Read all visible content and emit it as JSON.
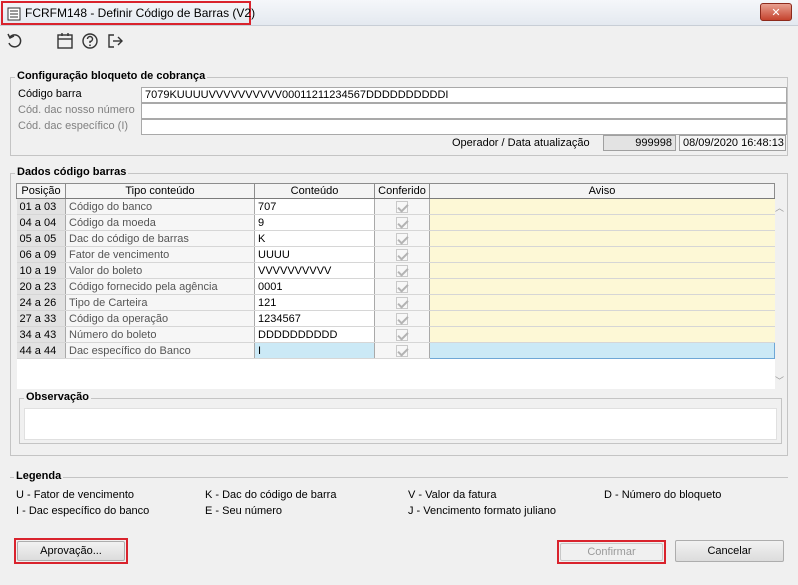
{
  "window": {
    "title": "FCRFM148 - Definir Código de Barras (V2)",
    "close_glyph": "✕"
  },
  "toolbar": {
    "icons": [
      "refresh-icon",
      "calendar-icon",
      "help-icon",
      "exit-icon"
    ]
  },
  "config": {
    "title": "Configuração bloqueto de cobrança",
    "codigo_barra_label": "Código barra",
    "codigo_barra_value": "7079KUUUUVVVVVVVVVV00011211234567DDDDDDDDDDI",
    "dac_nosso_numero_label": "Cód. dac nosso número",
    "dac_especifico_label": "Cód. dac específico (I)",
    "operador_label": "Operador / Data atualização",
    "operador_value": "999998",
    "data_value": "08/09/2020 16:48:13"
  },
  "dados": {
    "title": "Dados código barras",
    "columns": [
      "Posição",
      "Tipo conteúdo",
      "Conteúdo",
      "Conferido",
      "Aviso"
    ],
    "rows": [
      {
        "posicao": "01 a 03",
        "tipo": "Código do banco",
        "conteudo": "707",
        "conferido": true,
        "aviso": ""
      },
      {
        "posicao": "04 a 04",
        "tipo": "Código da moeda",
        "conteudo": "9",
        "conferido": true,
        "aviso": ""
      },
      {
        "posicao": "05 a 05",
        "tipo": "Dac do código de barras",
        "conteudo": "K",
        "conferido": true,
        "aviso": ""
      },
      {
        "posicao": "06 a 09",
        "tipo": "Fator de vencimento",
        "conteudo": "UUUU",
        "conferido": true,
        "aviso": ""
      },
      {
        "posicao": "10 a 19",
        "tipo": "Valor do boleto",
        "conteudo": "VVVVVVVVVV",
        "conferido": true,
        "aviso": ""
      },
      {
        "posicao": "20 a 23",
        "tipo": "Código fornecido pela agência",
        "conteudo": "0001",
        "conferido": true,
        "aviso": ""
      },
      {
        "posicao": "24 a 26",
        "tipo": "Tipo de Carteira",
        "conteudo": "121",
        "conferido": true,
        "aviso": ""
      },
      {
        "posicao": "27 a 33",
        "tipo": "Código da operação",
        "conteudo": "1234567",
        "conferido": true,
        "aviso": ""
      },
      {
        "posicao": "34 a 43",
        "tipo": "Número do boleto",
        "conteudo": "DDDDDDDDDD",
        "conferido": true,
        "aviso": ""
      },
      {
        "posicao": "44 a 44",
        "tipo": "Dac específico do Banco",
        "conteudo": "I",
        "conferido": true,
        "aviso": ""
      }
    ],
    "observacao_title": "Observação"
  },
  "legenda": {
    "title": "Legenda",
    "items": [
      "U - Fator de vencimento",
      "K - Dac do código de barra",
      "V - Valor da fatura",
      "D - Número do bloqueto",
      "I - Dac específico do banco",
      "E - Seu número",
      "J - Vencimento formato juliano"
    ]
  },
  "buttons": {
    "aprovacao": "Aprovação...",
    "confirmar": "Confirmar",
    "cancelar": "Cancelar"
  },
  "colors": {
    "highlight_outline": "#d9232d",
    "aviso_bg": "#fdf8d6",
    "active_row_bg": "#cbe9f6"
  }
}
